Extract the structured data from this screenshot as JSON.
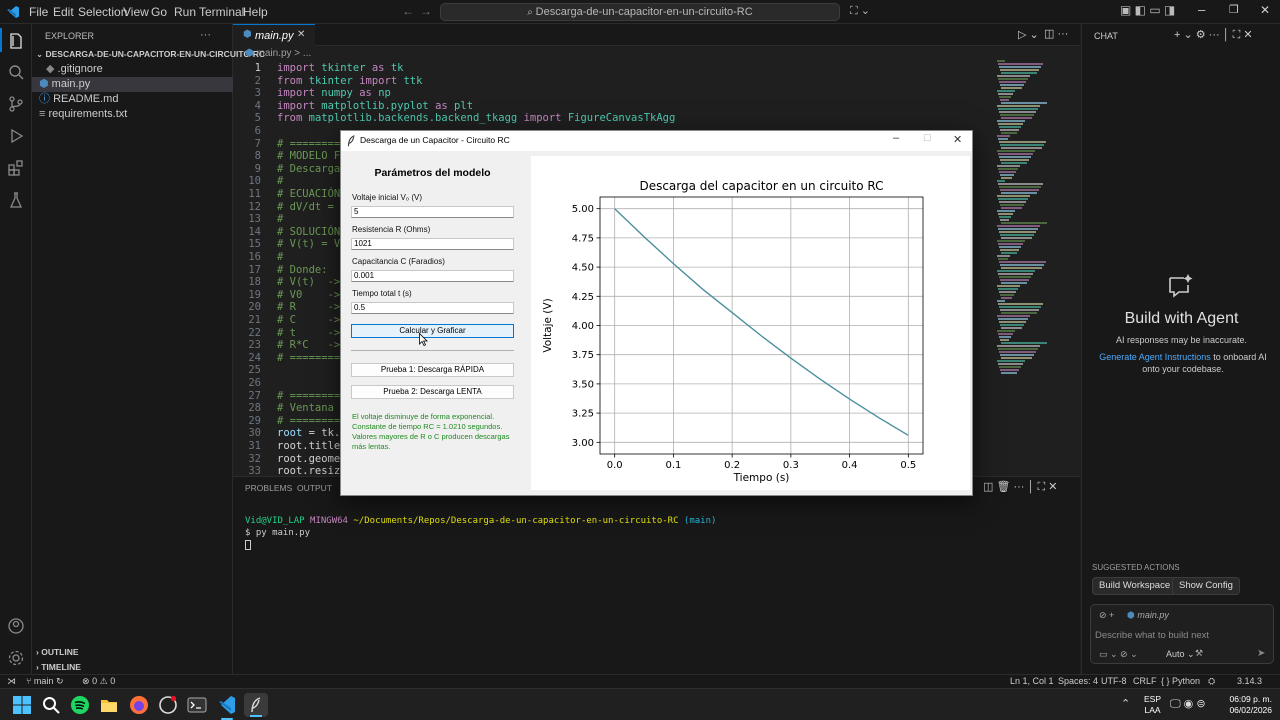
{
  "titlebar": {
    "menus": [
      "File",
      "Edit",
      "Selection",
      "View",
      "Go",
      "Run",
      "Terminal",
      "Help"
    ],
    "search": "Descarga-de-un-capacitor-en-un-circuito-RC"
  },
  "explorer": {
    "header": "EXPLORER",
    "project": "DESCARGA-DE-UN-CAPACITOR-EN-UN-CIRCUITO-RC",
    "files": [
      ".gitignore",
      "main.py",
      "README.md",
      "requirements.txt"
    ],
    "outline": "OUTLINE",
    "timeline": "TIMELINE"
  },
  "editor": {
    "tab": "main.py",
    "breadcrumb": "main.py > ...",
    "lines": [
      "import tkinter as tk",
      "from tkinter import ttk",
      "import numpy as np",
      "import matplotlib.pyplot as plt",
      "from matplotlib.backends.backend_tkagg import FigureCanvasTkAgg",
      "",
      "# ==========",
      "# MODELO FÍS",
      "# Descarga d",
      "#",
      "# ECUACIÓN D",
      "# dV/dt = -",
      "#",
      "# SOLUCIÓN A",
      "# V(t) = V0",
      "#",
      "# Donde:",
      "# V(t)  -> V",
      "# V0    -> V",
      "# R     -> R",
      "# C     -> C",
      "# t     -> T",
      "# R*C   -> C",
      "# ==========",
      "",
      "",
      "# ==========",
      "# Ventana pr",
      "# ==========",
      "root = tk.Tk",
      "root.title(\"",
      "root.geometr",
      "root.resizab"
    ]
  },
  "panel": {
    "tabs": [
      "PROBLEMS",
      "OUTPUT"
    ],
    "prompt_user": "Vid@VID_LAP",
    "prompt_env": "MINGW64",
    "prompt_path": "~/Documents/Repos/Descarga-de-un-capacitor-en-un-circuito-RC",
    "prompt_branch": "(main)",
    "command": "$ py main.py"
  },
  "chat": {
    "header": "CHAT",
    "title": "Build with Agent",
    "subtitle": "AI responses may be inaccurate.",
    "link": "Generate Agent Instructions",
    "link_rest": " to onboard AI onto your codebase.",
    "suggested_header": "SUGGESTED ACTIONS",
    "actions": [
      "Build Workspace",
      "Show Config"
    ],
    "context_file": "main.py",
    "placeholder": "Describe what to build next",
    "mode": "Auto"
  },
  "statusbar": {
    "branch": "main",
    "errors": "0",
    "warnings": "0",
    "position": "Ln 1, Col 1",
    "spaces": "Spaces: 4",
    "encoding": "UTF-8",
    "eol": "CRLF",
    "language": "Python",
    "version": "3.14.3"
  },
  "taskbar": {
    "lang1": "ESP",
    "lang2": "LAA",
    "time": "06:09 p. m.",
    "date": "06/02/2026"
  },
  "tkwindow": {
    "title": "Descarga de un Capacitor - Circuito RC",
    "params_title": "Parámetros del modelo",
    "fields": [
      {
        "label": "Voltaje inicial V₀ (V)",
        "value": "5"
      },
      {
        "label": "Resistencia R (Ohms)",
        "value": "1021"
      },
      {
        "label": "Capacitancia C (Faradios)",
        "value": "0.001"
      },
      {
        "label": "Tiempo total t (s)",
        "value": "0.5"
      }
    ],
    "btn_calc": "Calcular y Graficar",
    "btn_fast": "Prueba 1: Descarga RÁPIDA",
    "btn_slow": "Prueba 2: Descarga LENTA",
    "info": [
      "El voltaje disminuye de forma exponencial.",
      "Constante de tiempo RC = 1.0210 segundos.",
      "Valores mayores de R o C producen descargas",
      "más lentas."
    ]
  },
  "chart_data": {
    "type": "line",
    "title": "Descarga del capacitor en un circuito RC",
    "xlabel": "Tiempo (s)",
    "ylabel": "Voltaje (V)",
    "xlim": [
      -0.025,
      0.525
    ],
    "ylim": [
      2.9,
      5.1
    ],
    "xticks": [
      "0.0",
      "0.1",
      "0.2",
      "0.3",
      "0.4",
      "0.5"
    ],
    "yticks": [
      "3.00",
      "3.25",
      "3.50",
      "3.75",
      "4.00",
      "4.25",
      "4.50",
      "4.75",
      "5.00"
    ],
    "grid": true,
    "color": "#4c8fa0",
    "x": [
      0.0,
      0.05,
      0.1,
      0.15,
      0.2,
      0.25,
      0.3,
      0.35,
      0.4,
      0.45,
      0.5
    ],
    "y": [
      5.0,
      4.76,
      4.53,
      4.31,
      4.11,
      3.91,
      3.72,
      3.54,
      3.37,
      3.21,
      3.06
    ]
  }
}
